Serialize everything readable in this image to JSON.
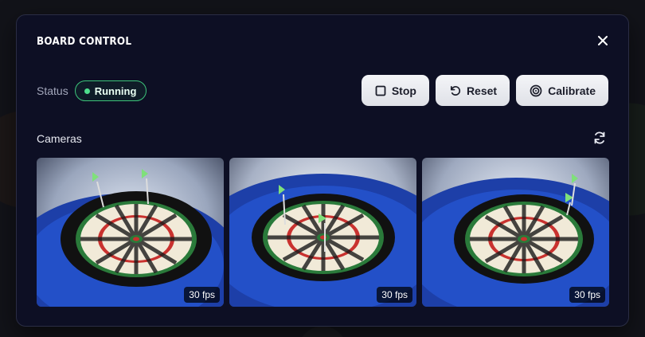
{
  "modal": {
    "title": "BOARD CONTROL",
    "close_icon": "close-icon"
  },
  "status": {
    "label": "Status",
    "value": "Running",
    "color": "#3cc47a"
  },
  "actions": [
    {
      "label": "Stop",
      "icon": "square-icon"
    },
    {
      "label": "Reset",
      "icon": "reset-icon"
    },
    {
      "label": "Calibrate",
      "icon": "target-icon"
    }
  ],
  "cameras": {
    "label": "Cameras",
    "refresh_icon": "refresh-icon",
    "feeds": [
      {
        "fps": "30 fps"
      },
      {
        "fps": "30 fps"
      },
      {
        "fps": "30 fps"
      }
    ]
  }
}
